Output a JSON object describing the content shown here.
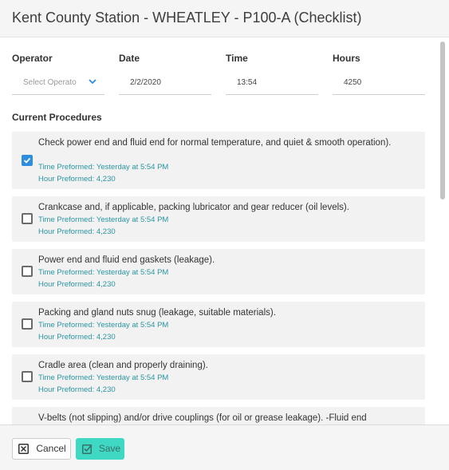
{
  "header": {
    "title": "Kent County Station - WHEATLEY - P100-A (Checklist)"
  },
  "fields": {
    "operator": {
      "label": "Operator",
      "placeholder": "Select Operato"
    },
    "date": {
      "label": "Date",
      "value": "2/2/2020"
    },
    "time": {
      "label": "Time",
      "value": "13:54"
    },
    "hours": {
      "label": "Hours",
      "value": "4250"
    }
  },
  "section_title": "Current Procedures",
  "procedures": [
    {
      "text": "Check power end and fluid end for normal temperature, and quiet & smooth operation).",
      "time": "Time Preformed: Yesterday at 5:54 PM",
      "hour": "Hour Preformed: 4,230",
      "checked": true
    },
    {
      "text": "Crankcase and, if applicable, packing lubricator and gear reducer (oil levels).",
      "time": "Time Preformed: Yesterday at 5:54 PM",
      "hour": "Hour Preformed: 4,230",
      "checked": false
    },
    {
      "text": "Power end and fluid end gaskets (leakage).",
      "time": "Time Preformed: Yesterday at 5:54 PM",
      "hour": "Hour Preformed: 4,230",
      "checked": false
    },
    {
      "text": "Packing and gland nuts snug (leakage, suitable materials).",
      "time": "Time Preformed: Yesterday at 5:54 PM",
      "hour": "Hour Preformed: 4,230",
      "checked": false
    },
    {
      "text": "Cradle area (clean and properly draining).",
      "time": "Time Preformed: Yesterday at 5:54 PM",
      "hour": "Hour Preformed: 4,230",
      "checked": false
    },
    {
      "text": "V-belts (not slipping) and/or drive couplings (for oil or grease leakage). -Fluid end",
      "checked": false
    }
  ],
  "footer": {
    "cancel_label": "Cancel",
    "save_label": "Save"
  },
  "colors": {
    "accent": "#3fd9c3",
    "checkbox_checked": "#2f8dde",
    "meta_text": "#2a95a3"
  }
}
